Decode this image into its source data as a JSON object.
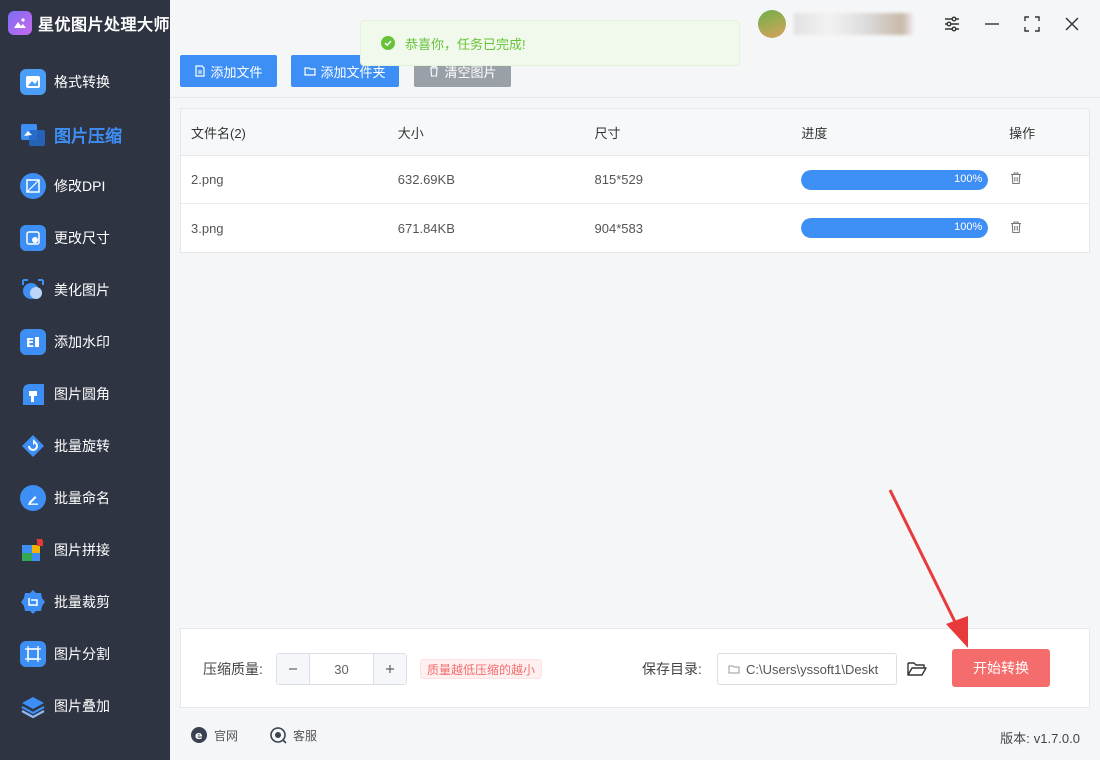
{
  "app": {
    "title": "星优图片处理大师"
  },
  "sidebar": {
    "items": [
      {
        "label": "格式转换",
        "icon": "format-convert-icon",
        "active": false
      },
      {
        "label": "图片压缩",
        "icon": "image-compress-icon",
        "active": true
      },
      {
        "label": "修改DPI",
        "icon": "dpi-icon",
        "active": false
      },
      {
        "label": "更改尺寸",
        "icon": "resize-icon",
        "active": false
      },
      {
        "label": "美化图片",
        "icon": "beautify-icon",
        "active": false
      },
      {
        "label": "添加水印",
        "icon": "watermark-icon",
        "active": false
      },
      {
        "label": "图片圆角",
        "icon": "rounded-corner-icon",
        "active": false
      },
      {
        "label": "批量旋转",
        "icon": "rotate-icon",
        "active": false
      },
      {
        "label": "批量命名",
        "icon": "rename-icon",
        "active": false
      },
      {
        "label": "图片拼接",
        "icon": "stitch-icon",
        "active": false
      },
      {
        "label": "批量裁剪",
        "icon": "crop-icon",
        "active": false
      },
      {
        "label": "图片分割",
        "icon": "split-icon",
        "active": false
      },
      {
        "label": "图片叠加",
        "icon": "overlay-icon",
        "active": false
      }
    ]
  },
  "toolbar": {
    "add_file": "添加文件",
    "add_folder": "添加文件夹",
    "clear": "清空图片"
  },
  "toast": {
    "message": "恭喜你，任务已完成!"
  },
  "table": {
    "headers": [
      "文件名(2)",
      "大小",
      "尺寸",
      "进度",
      "操作"
    ],
    "rows": [
      {
        "name": "2.png",
        "size": "632.69KB",
        "dims": "815*529",
        "progress": 100,
        "progress_label": "100%"
      },
      {
        "name": "3.png",
        "size": "671.84KB",
        "dims": "904*583",
        "progress": 100,
        "progress_label": "100%"
      }
    ]
  },
  "settings": {
    "quality_label": "压缩质量:",
    "quality_value": "30",
    "quality_hint": "质量越低压缩的越小",
    "dir_label": "保存目录:",
    "dir_value": "C:\\Users\\yssoft1\\Deskt",
    "start_button": "开始转换"
  },
  "footer": {
    "website": "官网",
    "support": "客服",
    "version_label": "版本:",
    "version_value": "v1.7.0.0"
  },
  "colors": {
    "sidebar_bg": "#2f3442",
    "accent": "#3d8ff5",
    "danger": "#f56c6c",
    "success": "#67c23a"
  }
}
